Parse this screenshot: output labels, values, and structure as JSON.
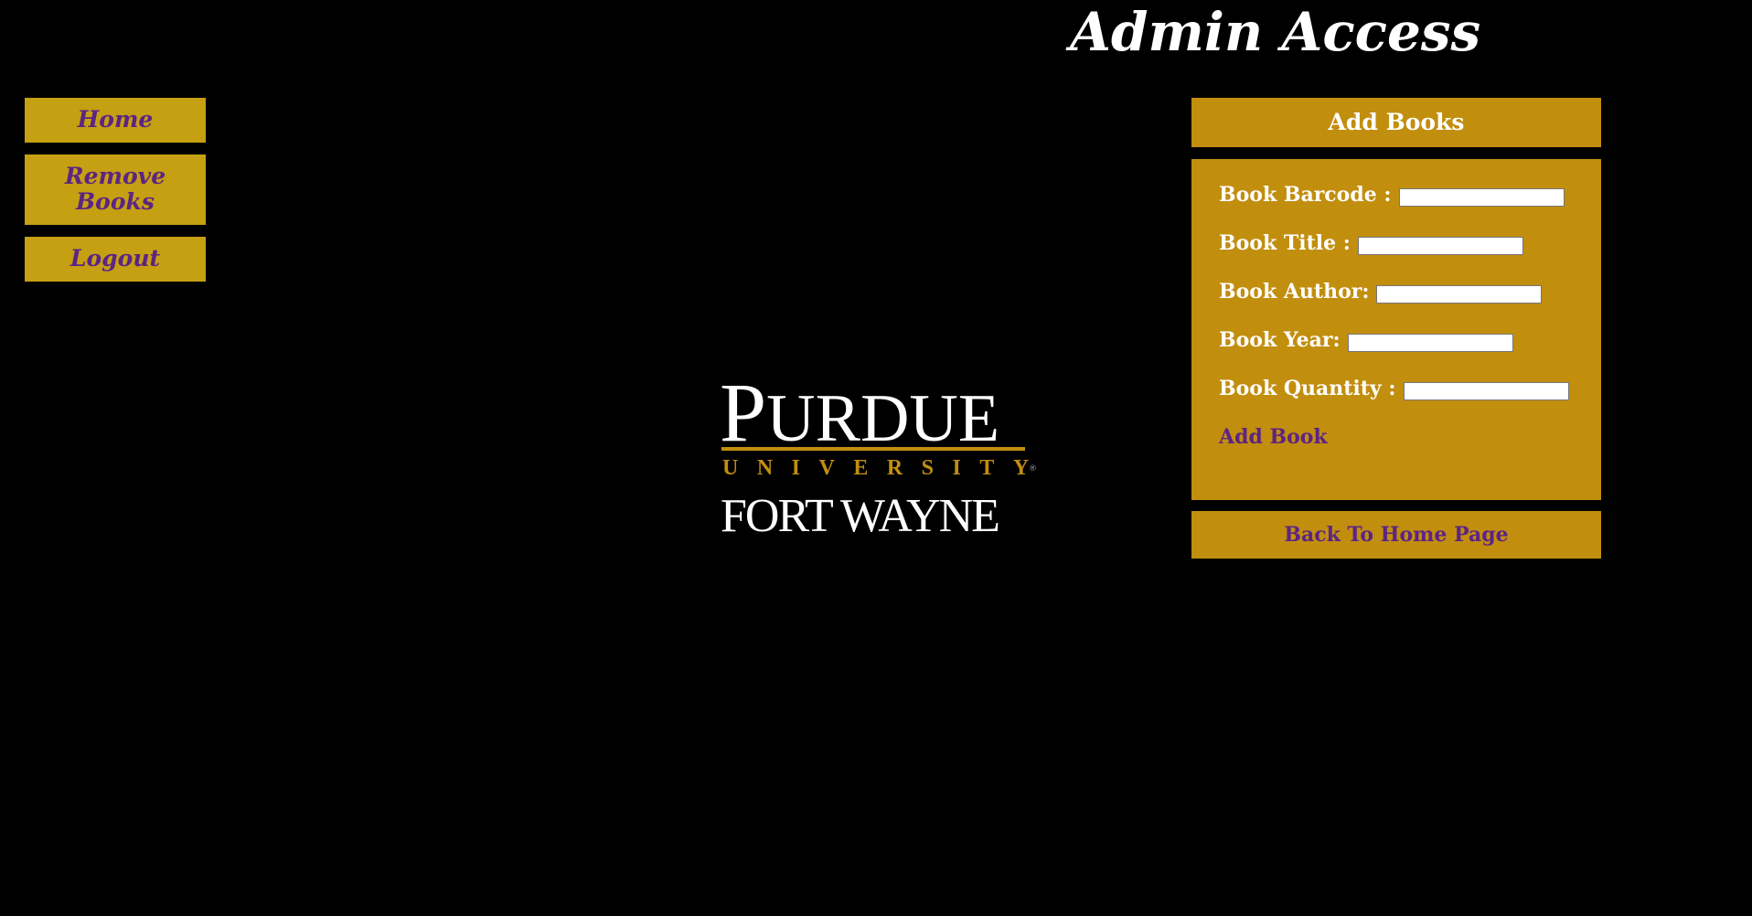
{
  "header": {
    "title": "Admin Access"
  },
  "nav": {
    "home": "Home",
    "remove_books_line1": "Remove",
    "remove_books_line2": "Books",
    "logout": "Logout"
  },
  "logo": {
    "purdue_initial": "P",
    "purdue_rest": "URDUE",
    "university": "UNIVERSITY",
    "registered": "®",
    "campus": "FORT WAYNE"
  },
  "add_books": {
    "header": "Add Books",
    "fields": [
      {
        "label": "Book Barcode :",
        "value": ""
      },
      {
        "label": "Book Title :",
        "value": ""
      },
      {
        "label": "Book Author:",
        "value": ""
      },
      {
        "label": "Book Year:",
        "value": ""
      },
      {
        "label": "Book Quantity :",
        "value": ""
      }
    ],
    "submit_label": "Add Book"
  },
  "back_button": {
    "label": "Back To Home Page"
  },
  "colors": {
    "background": "#000000",
    "nav_gold": "#c5a012",
    "panel_gold": "#c28e0e",
    "purple": "#5c2483",
    "white": "#ffffff"
  }
}
